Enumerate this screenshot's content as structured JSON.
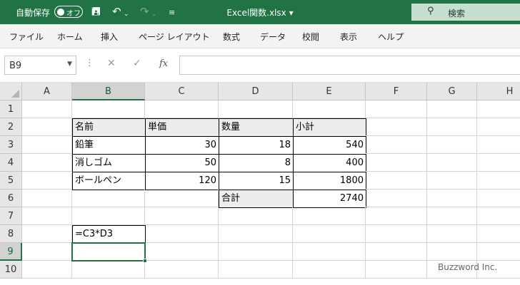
{
  "titlebar": {
    "autosave_label": "自動保存",
    "autosave_state": "オフ",
    "doc_title": "Excel関数.xlsx ▾",
    "search_placeholder": "検索",
    "save_icon": "save-icon",
    "undo_icon": "undo-icon",
    "redo_icon": "redo-icon",
    "customize_icon": "customize-qat-icon",
    "accent": "#217346"
  },
  "ribbon": {
    "tabs": [
      "ファイル",
      "ホーム",
      "挿入",
      "ページ レイアウト",
      "数式",
      "データ",
      "校閲",
      "表示",
      "ヘルプ"
    ]
  },
  "formula_bar": {
    "name_box": "B9",
    "formula": ""
  },
  "sheet": {
    "columns": [
      "A",
      "B",
      "C",
      "D",
      "E",
      "F",
      "G",
      "H"
    ],
    "rows": [
      "1",
      "2",
      "3",
      "4",
      "5",
      "6",
      "7",
      "8",
      "9",
      "10"
    ],
    "selected_column": "B",
    "selected_row": "9",
    "cells": {
      "B2": "名前",
      "C2": "単価",
      "D2": "数量",
      "E2": "小計",
      "B3": "鉛筆",
      "C3": "30",
      "D3": "18",
      "E3": "540",
      "B4": "消しゴム",
      "C4": "50",
      "D4": "8",
      "E4": "400",
      "B5": "ボールペン",
      "C5": "120",
      "D5": "15",
      "E5": "1800",
      "D6": "合計",
      "E6": "2740",
      "B8": "=C3*D3"
    }
  },
  "watermark": "Buzzword Inc."
}
